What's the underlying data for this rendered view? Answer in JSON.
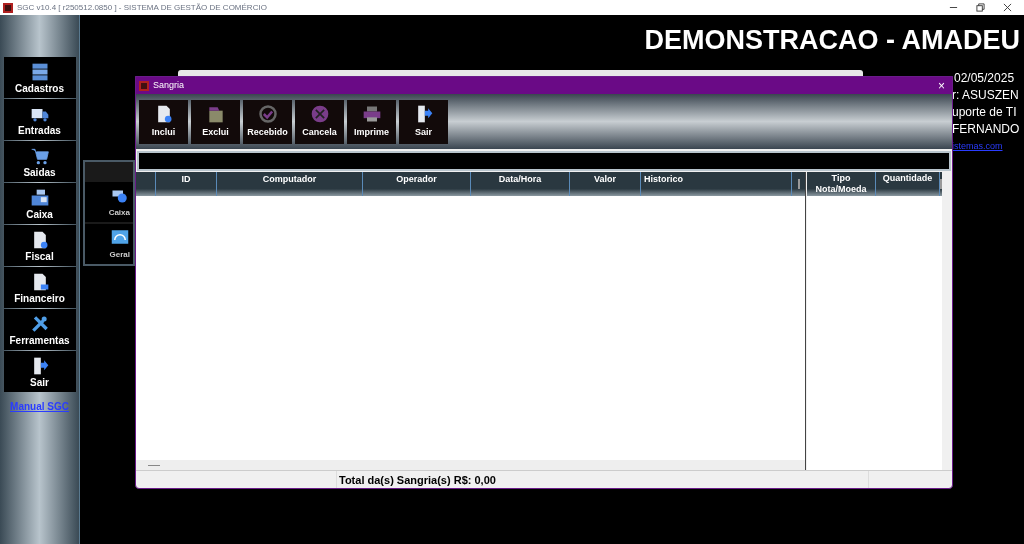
{
  "window": {
    "title": "SGC v10.4 [ r250512.0850 ] - SISTEMA DE GESTÃO DE COMÉRCIO"
  },
  "header": {
    "company": "DEMONSTRACAO - AMADEU"
  },
  "info": [
    {
      "text": "02/05/2025",
      "kind": "text"
    },
    {
      "text": "r: ASUSZEN",
      "kind": "text"
    },
    {
      "text": "uporte de TI",
      "kind": "text"
    },
    {
      "text": "FERNANDO",
      "kind": "text"
    },
    {
      "text": "istemas.com",
      "kind": "link"
    }
  ],
  "sidebar": {
    "items": [
      {
        "label": "Cadastros"
      },
      {
        "label": "Entradas"
      },
      {
        "label": "Saidas"
      },
      {
        "label": "Caixa"
      },
      {
        "label": "Fiscal"
      },
      {
        "label": "Financeiro"
      },
      {
        "label": "Ferramentas"
      },
      {
        "label": "Sair"
      }
    ],
    "link": "Manual SGC"
  },
  "submenu": {
    "items": [
      {
        "label": "Caixa"
      },
      {
        "label": "Geral"
      }
    ]
  },
  "dialog": {
    "title": "Sangria",
    "close": "×",
    "toolbar": [
      {
        "label": "Inclui"
      },
      {
        "label": "Exclui"
      },
      {
        "label": "Recebido"
      },
      {
        "label": "Cancela"
      },
      {
        "label": "Imprime"
      },
      {
        "label": "Sair"
      }
    ],
    "table": {
      "columns": [
        "",
        "ID",
        "Computador",
        "Operador",
        "Data/Hora",
        "Valor",
        "Historico"
      ]
    },
    "side_table": {
      "columns": [
        "Tipo Nota/Moeda",
        "Quantidade"
      ]
    },
    "status_bar": "Total da(s) Sangria(s) R$: 0,00"
  }
}
